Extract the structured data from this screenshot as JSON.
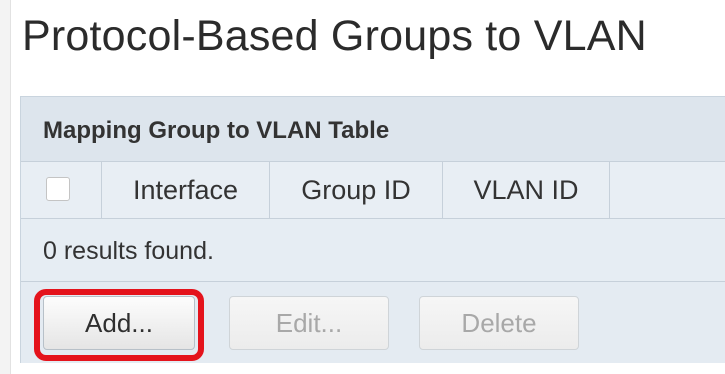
{
  "page": {
    "title": "Protocol-Based Groups to VLAN"
  },
  "table": {
    "caption": "Mapping Group to VLAN Table",
    "columns": [
      "Interface",
      "Group ID",
      "VLAN ID"
    ],
    "select_all_checked": false,
    "rows": [],
    "results_text": "0 results found."
  },
  "buttons": {
    "add": "Add...",
    "edit": "Edit...",
    "delete": "Delete"
  },
  "colors": {
    "highlight": "#e4131c",
    "panel_background": "#e4ebf2"
  },
  "icons": {
    "select_all": "checkbox-icon"
  }
}
